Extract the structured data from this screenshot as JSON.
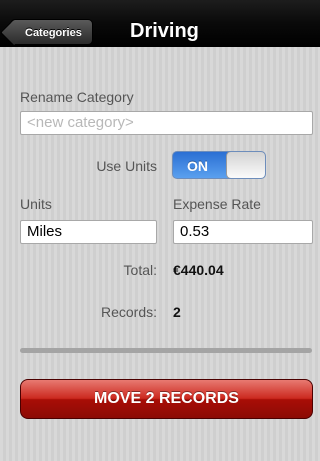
{
  "colors": {
    "navbar": "#000000",
    "toggle_on": "#3b82e0",
    "move_button": "#b5140b",
    "background": "#d4d4d4"
  },
  "nav": {
    "back_label": "Categories",
    "title": "Driving"
  },
  "rename": {
    "label": "Rename Category",
    "placeholder": "<new category>"
  },
  "use_units": {
    "label": "Use Units",
    "state": "ON",
    "on": true
  },
  "units": {
    "label": "Units",
    "value": "Miles"
  },
  "expense_rate": {
    "label": "Expense Rate",
    "value": "0.53"
  },
  "total": {
    "label": "Total:",
    "value": "€440.04"
  },
  "records": {
    "label": "Records:",
    "value": "2"
  },
  "move_button": {
    "label": "MOVE 2 RECORDS"
  }
}
